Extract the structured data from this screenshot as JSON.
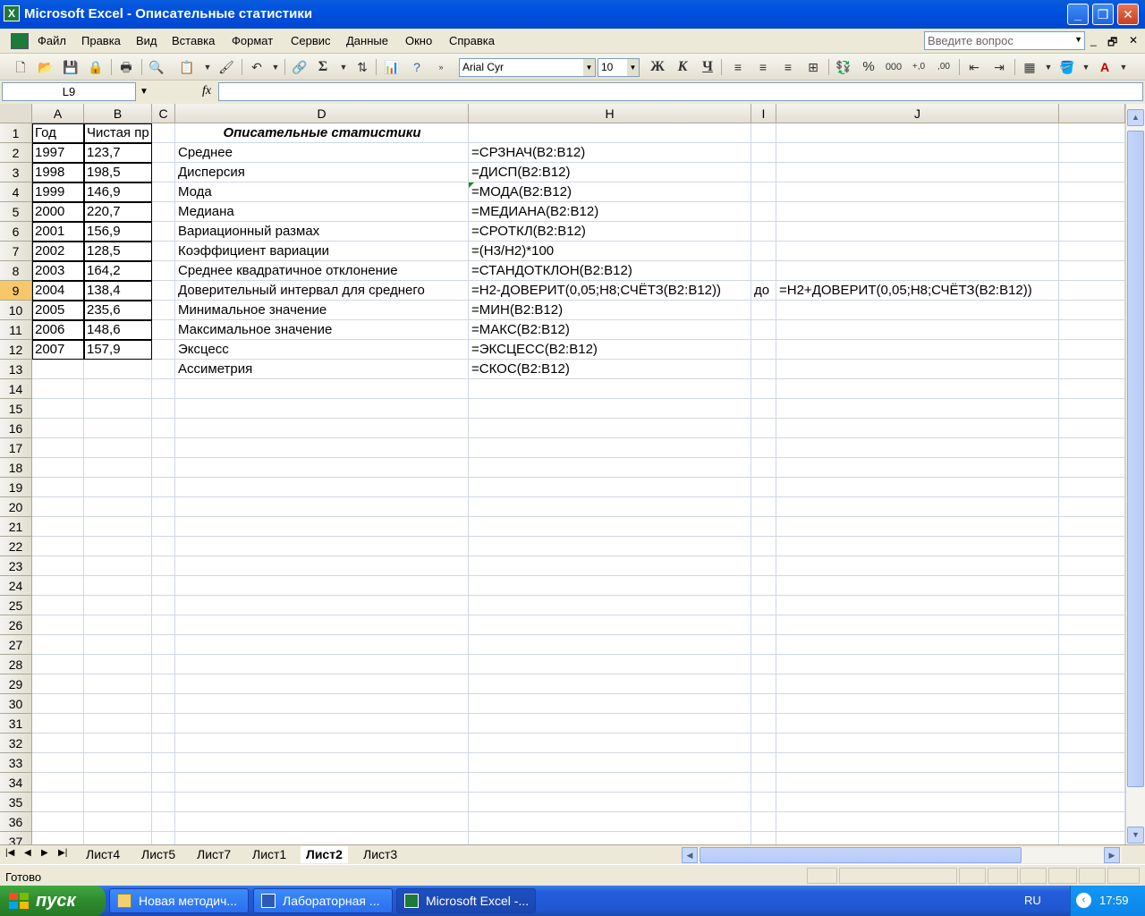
{
  "window": {
    "title": "Microsoft Excel - Описательные статистики",
    "app_icon": "excel-icon"
  },
  "menu": {
    "items": [
      "Файл",
      "Правка",
      "Вид",
      "Вставка",
      "Формат",
      "Сервис",
      "Данные",
      "Окно",
      "Справка"
    ],
    "help_placeholder": "Введите вопрос"
  },
  "toolbar": {
    "font_name": "Arial Cyr",
    "font_size": "10",
    "bold_label": "Ж",
    "italic_label": "К",
    "underline_label": "Ч",
    "percent_label": "%",
    "thousands_label": "000",
    "sum_label": "Σ"
  },
  "formula_bar": {
    "name_box": "L9",
    "fx_label": "fx",
    "formula": ""
  },
  "grid": {
    "columns": [
      "A",
      "B",
      "C",
      "D",
      "H",
      "I",
      "J"
    ],
    "rows": [
      "1",
      "2",
      "3",
      "4",
      "5",
      "6",
      "7",
      "8",
      "9",
      "10",
      "11",
      "12",
      "13",
      "14",
      "15",
      "16",
      "17",
      "18",
      "19",
      "20",
      "21",
      "22",
      "23",
      "24",
      "25",
      "26",
      "27",
      "28",
      "29",
      "30",
      "31",
      "32",
      "33",
      "34",
      "35",
      "36",
      "37"
    ],
    "selected_row": "9",
    "table_headers": [
      "Год",
      "Чистая пр"
    ],
    "years": [
      "1997",
      "1998",
      "1999",
      "2000",
      "2001",
      "2002",
      "2003",
      "2004",
      "2005",
      "2006",
      "2007"
    ],
    "values": [
      "123,7",
      "198,5",
      "146,9",
      "220,7",
      "156,9",
      "128,5",
      "164,2",
      "138,4",
      "235,6",
      "148,6",
      "157,9"
    ],
    "stats_title": "Описательные статистики",
    "stat_labels": [
      "Среднее",
      "Дисперсия",
      "Мода",
      "Медиана",
      "Вариационный размах",
      "Коэффициент вариации",
      "Среднее квадратичное отклонение",
      "Доверительный интервал для среднего",
      "Минимальное значение",
      "Максимальное значение",
      "Эксцесс",
      "Ассиметрия"
    ],
    "formulas": [
      "=СРЗНАЧ(B2:B12)",
      "=ДИСП(B2:B12)",
      "=МОДА(B2:B12)",
      "=МЕДИАНА(B2:B12)",
      "=СРОТКЛ(B2:B12)",
      "=(H3/H2)*100",
      "=СТАНДОТКЛОН(B2:B12)",
      "=H2-ДОВЕРИТ(0,05;H8;СЧЁТЗ(B2:B12))",
      "=МИН(B2:B12)",
      "=МАКС(B2:B12)",
      "=ЭКСЦЕСС(B2:B12)",
      "=СКОС(B2:B12)"
    ],
    "i9_text": "до",
    "j9_formula": "=H2+ДОВЕРИТ(0,05;H8;СЧЁТЗ(B2:B12))"
  },
  "sheets": {
    "tabs": [
      "Лист4",
      "Лист5",
      "Лист7",
      "Лист1",
      "Лист2",
      "Лист3"
    ],
    "active": "Лист2"
  },
  "status": {
    "text": "Готово"
  },
  "taskbar": {
    "start_label": "пуск",
    "buttons": [
      "Новая методич...",
      "Лабораторная ...",
      "Microsoft Excel -..."
    ],
    "lang": "RU",
    "clock": "17:59"
  }
}
